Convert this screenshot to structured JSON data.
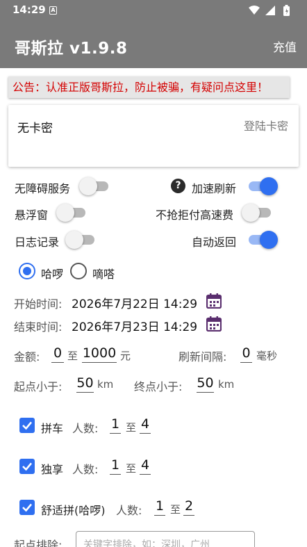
{
  "status_bar": {
    "time": "14:29",
    "sim_badge": "A"
  },
  "app_bar": {
    "title": "哥斯拉 v1.9.8",
    "recharge": "充值"
  },
  "notice": "公告：认准正版哥斯拉，防止被骗，有疑问点这里！",
  "card": {
    "key_status": "无卡密",
    "login": "登陆卡密"
  },
  "toggles": [
    {
      "label": "无障碍服务",
      "on": false
    },
    {
      "label": "加速刷新",
      "on": true
    },
    {
      "label": "悬浮窗",
      "on": false
    },
    {
      "label": "不抢拒付高速费",
      "on": false
    },
    {
      "label": "日志记录",
      "on": false
    },
    {
      "label": "自动返回",
      "on": true
    }
  ],
  "radios": [
    {
      "label": "哈啰",
      "checked": true
    },
    {
      "label": "嘀嗒",
      "checked": false
    }
  ],
  "time": {
    "start_label": "开始时间:",
    "start_value": "2026年7月22日 14:29",
    "end_label": "结束时间:",
    "end_value": "2026年7月23日 14:29"
  },
  "amount": {
    "label": "金额:",
    "min": "0",
    "to": "至",
    "max": "1000",
    "unit": "元"
  },
  "refresh": {
    "label": "刷新间隔:",
    "value": "0",
    "unit": "毫秒"
  },
  "distance": {
    "start_label": "起点小于:",
    "start_value": "50",
    "start_unit": "km",
    "end_label": "终点小于:",
    "end_value": "50",
    "end_unit": "km"
  },
  "ride_types": [
    {
      "label": "拼车",
      "checked": true,
      "people_label": "人数:",
      "min": "1",
      "to": "至",
      "max": "4"
    },
    {
      "label": "独享",
      "checked": true,
      "people_label": "人数:",
      "min": "1",
      "to": "至",
      "max": "4"
    },
    {
      "label": "舒适拼(哈啰)",
      "checked": true,
      "people_label": "人数:",
      "min": "1",
      "to": "至",
      "max": "2"
    }
  ],
  "exclude": {
    "label": "起点排除:",
    "placeholder": "关键字排除，如：深圳，广州"
  }
}
